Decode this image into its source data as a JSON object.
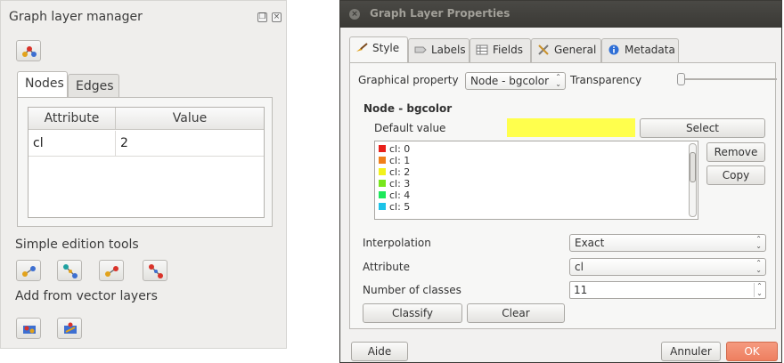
{
  "left_panel": {
    "title": "Graph layer manager",
    "tabs": [
      "Nodes",
      "Edges"
    ],
    "table": {
      "headers": [
        "Attribute",
        "Value"
      ],
      "rows": [
        [
          "cl",
          "2"
        ]
      ]
    },
    "simple_tools_label": "Simple edition tools",
    "vector_layers_label": "Add from vector layers"
  },
  "dialog": {
    "title": "Graph Layer Properties",
    "tabs": [
      "Style",
      "Labels",
      "Fields",
      "General",
      "Metadata"
    ],
    "graphical_property_label": "Graphical property",
    "graphical_property_value": "Node - bgcolor",
    "transparency_label": "Transparency",
    "section_title": "Node - bgcolor",
    "default_value_label": "Default value",
    "default_color": "#ffff4d",
    "select_label": "Select",
    "remove_label": "Remove",
    "copy_label": "Copy",
    "classes": [
      {
        "label": "cl: 0",
        "color": "#e8201a"
      },
      {
        "label": "cl: 1",
        "color": "#f07f1a"
      },
      {
        "label": "cl: 2",
        "color": "#f2f21c"
      },
      {
        "label": "cl: 3",
        "color": "#78e61c"
      },
      {
        "label": "cl: 4",
        "color": "#1ce85a"
      },
      {
        "label": "cl: 5",
        "color": "#1cc3e8"
      }
    ],
    "interpolation_label": "Interpolation",
    "interpolation_value": "Exact",
    "attribute_label": "Attribute",
    "attribute_value": "cl",
    "num_classes_label": "Number of classes",
    "num_classes_value": "11",
    "classify_label": "Classify",
    "clear_label": "Clear",
    "help_label": "Aide",
    "cancel_label": "Annuler",
    "ok_label": "OK"
  }
}
